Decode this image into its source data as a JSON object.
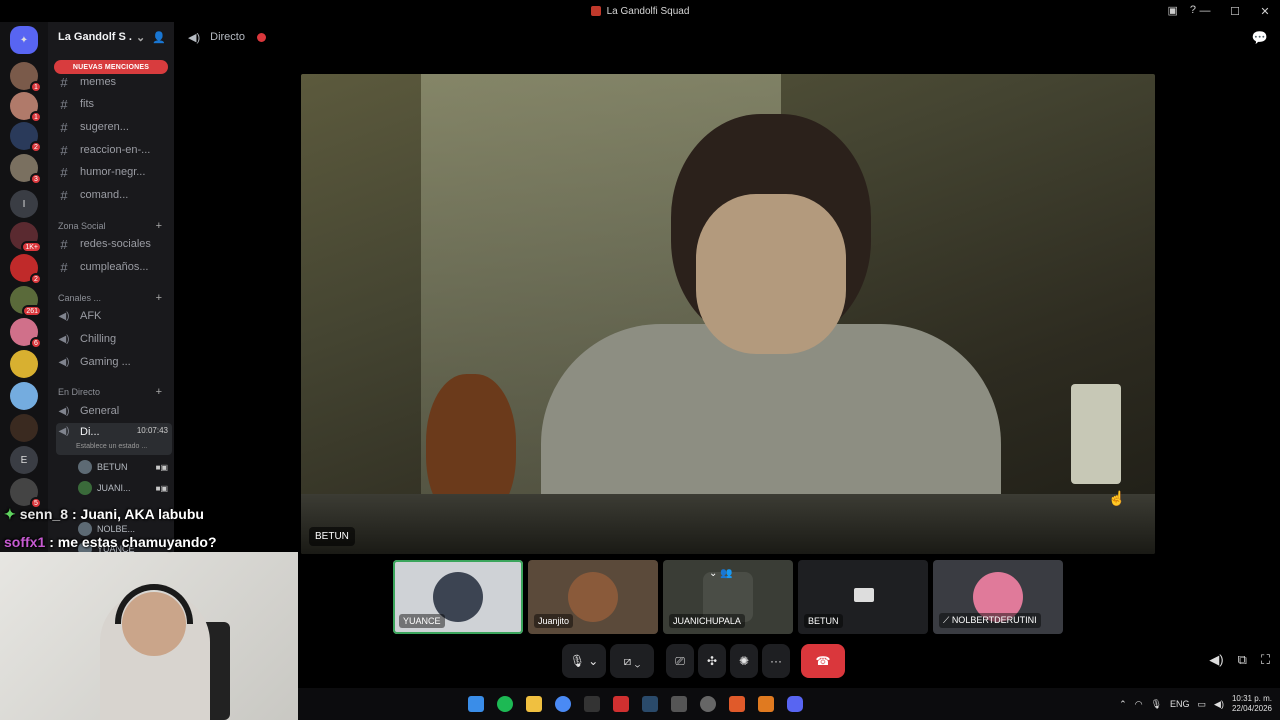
{
  "window": {
    "title": "La Gandolfi Squad"
  },
  "server": {
    "name": "La Gandolf S .",
    "new_mentions": "NUEVAS MENCIONES"
  },
  "channels": [
    {
      "label": "memes",
      "top": 0
    },
    {
      "label": "fits"
    },
    {
      "label": "sugeren..."
    },
    {
      "label": "reaccion-en-..."
    },
    {
      "label": "humor-negr..."
    },
    {
      "label": "comand..."
    }
  ],
  "categories": {
    "zona_social": "Zona Social",
    "canales": "Canales ...",
    "en_directo": "En Directo"
  },
  "social_channels": [
    "redes-sociales",
    "cumpleaños..."
  ],
  "voice_channels": [
    "AFK",
    "Chilling",
    "Gaming ..."
  ],
  "live_channels": {
    "general": "General",
    "active": "Di...",
    "timer": "10:07:43",
    "status": "Establece un estado ..."
  },
  "voice_users": [
    "BETUN",
    "JUANI...",
    "NOLBE...",
    "YUANCE"
  ],
  "guild_badges": [
    "1",
    "1",
    "2",
    "3",
    "1K+",
    "2",
    "261",
    "6",
    "5"
  ],
  "guild_letters": [
    "I",
    "E"
  ],
  "topbar": {
    "channel": "Directo"
  },
  "main_video": {
    "name": "BETUN"
  },
  "tiles": [
    {
      "label": "YUANCE"
    },
    {
      "label": "Juanjito"
    },
    {
      "label": "JUANICHUPALA"
    },
    {
      "label": "BETUN"
    },
    {
      "label": "NOLBERTDERUTINI"
    }
  ],
  "chat_overlay": [
    {
      "user": "senn_8",
      "message": ": Juani, AKA labubu"
    },
    {
      "user": "soffx1",
      "message": ": me estas chamuyando?"
    }
  ],
  "taskbar": {
    "lang": "ENG",
    "time": "10:31 p. m.",
    "date": "22/04/2026"
  },
  "icons": {
    "discord": "discord-icon",
    "mic": "microphone-icon",
    "camera": "camera-off-icon",
    "share": "screen-share-icon",
    "activities": "activities-icon",
    "soundboard": "soundboard-icon",
    "more": "more-icon",
    "hangup": "hang-up-icon"
  },
  "colors": {
    "accent_red": "#da373c",
    "speaking_green": "#3ba55c",
    "sidebar": "#19191c"
  }
}
